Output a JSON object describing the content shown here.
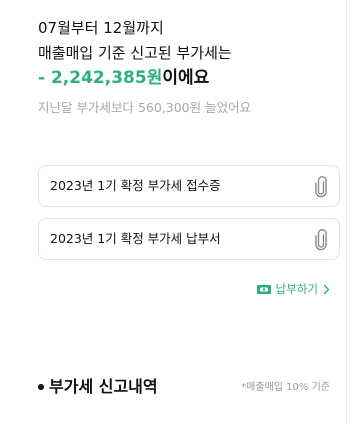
{
  "summary": {
    "period": "07월부터 12월까지",
    "subtitle": "매출매입 기준 신고된 부가세는",
    "amount": "- 2,242,385원",
    "amount_suffix": "이에요",
    "comparison": "지난달 부가세보다 560,300원 늘었어요"
  },
  "documents": [
    {
      "label": "2023년 1기 확정 부가세 접수증",
      "icon": "paperclip-icon"
    },
    {
      "label": "2023년 1기 확정 부가세 납부서",
      "icon": "paperclip-icon"
    }
  ],
  "pay_action": {
    "label": "납부하기",
    "icon": "card-payment-icon",
    "chevron": "chevron-right-icon"
  },
  "history": {
    "title": "부가세 신고내역",
    "note": "*매출매입 10% 기준"
  },
  "colors": {
    "accent": "#2cb17a",
    "muted_text": "#a8a8a8",
    "border": "#e2e2e2"
  }
}
